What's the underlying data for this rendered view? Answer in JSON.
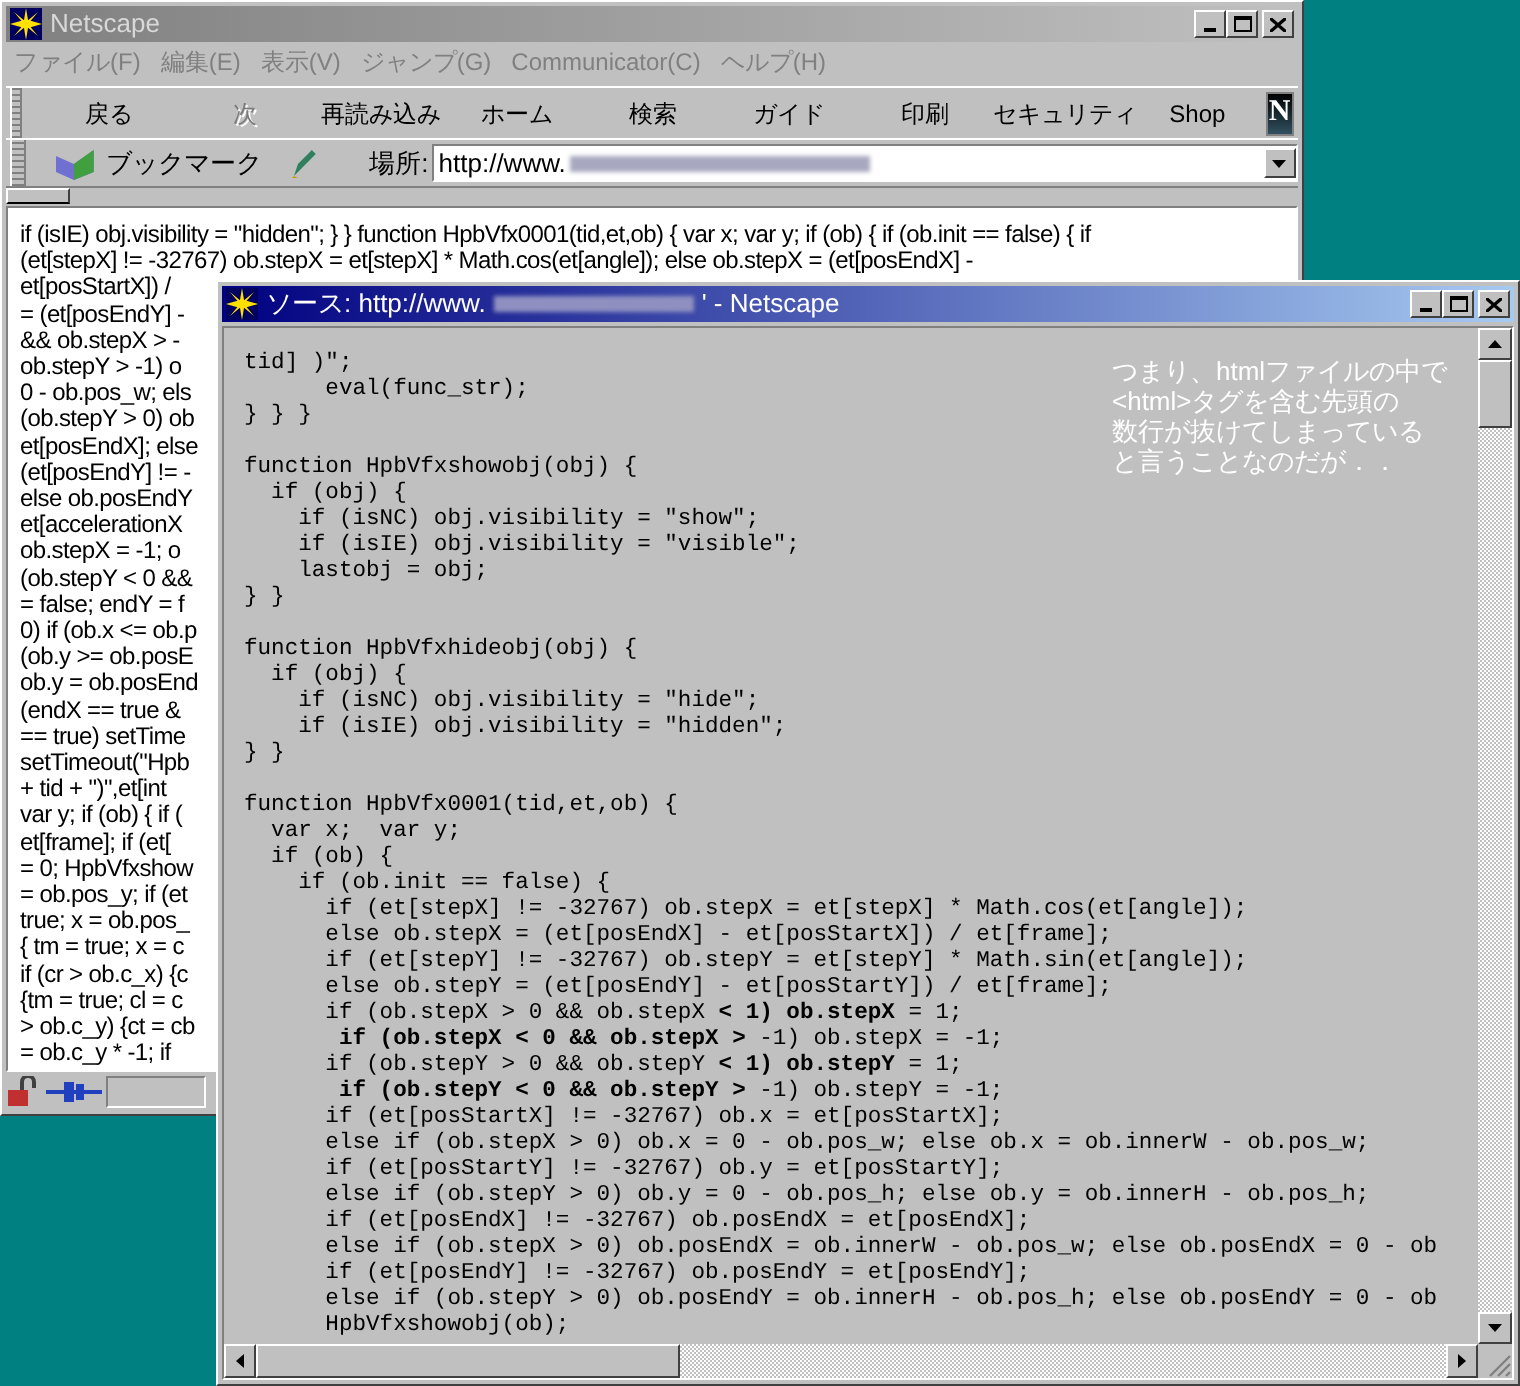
{
  "browser_window": {
    "title": "Netscape",
    "menu": [
      "ファイル(F)",
      "編集(E)",
      "表示(V)",
      "ジャンプ(G)",
      "Communicator(C)",
      "ヘルプ(H)"
    ],
    "toolbar": [
      {
        "label": "戻る",
        "disabled": false
      },
      {
        "label": "次",
        "disabled": true
      },
      {
        "label": "再読み込み",
        "disabled": false
      },
      {
        "label": "ホーム",
        "disabled": false
      },
      {
        "label": "検索",
        "disabled": false
      },
      {
        "label": "ガイド",
        "disabled": false
      },
      {
        "label": "印刷",
        "disabled": false
      },
      {
        "label": "セキュリティ",
        "disabled": false
      },
      {
        "label": "Shop",
        "disabled": false
      }
    ],
    "logo": "N",
    "bookmarks_label": "ブックマーク",
    "location_label": "場所:",
    "location_value": "http://www.",
    "page_lines": [
      "if (isIE) obj.visibility = \"hidden\"; } } function HpbVfx0001(tid,et,ob) { var x; var y; if (ob) { if (ob.init == false) { if",
      "(et[stepX] != -32767) ob.stepX = et[stepX] * Math.cos(et[angle]); else ob.stepX = (et[posEndX] -",
      "et[posStartX]) /",
      "= (et[posEndY] -",
      "&& ob.stepX > -",
      "ob.stepY > -1) o",
      "0 - ob.pos_w; els",
      "(ob.stepY > 0) ob",
      "et[posEndX]; else",
      "(et[posEndY] != -",
      "else ob.posEndY",
      "et[accelerationX",
      "ob.stepX = -1; o",
      "(ob.stepY < 0 &&",
      "= false; endY = f",
      "0) if (ob.x <= ob.p",
      "(ob.y >= ob.posE",
      "ob.y = ob.posEnd",
      "(endX == true &",
      "== true) setTime",
      "setTimeout(\"Hpb",
      "+ tid + \")\",et[int",
      "var y; if (ob) { if (",
      "et[frame]; if (et[",
      "= 0; HpbVfxshow",
      "= ob.pos_y; if (et",
      "true; x = ob.pos_",
      "{ tm = true; x = c",
      "if (cr > ob.c_x) {c",
      "{tm = true; cl = c",
      "> ob.c_y) {ct = cb",
      "= ob.c_y * -1; if"
    ]
  },
  "source_window": {
    "title_prefix": "ソース: http://www.",
    "title_suffix": "' - Netscape",
    "code_blocks": [
      [
        "tid] )\";",
        "      eval(func_str);",
        "} } }"
      ],
      [
        "function HpbVfxshowobj(obj) {",
        "  if (obj) {",
        "    if (isNC) obj.visibility = \"show\";",
        "    if (isIE) obj.visibility = \"visible\";",
        "    lastobj = obj;",
        "} }"
      ],
      [
        "function HpbVfxhideobj(obj) {",
        "  if (obj) {",
        "    if (isNC) obj.visibility = \"hide\";",
        "    if (isIE) obj.visibility = \"hidden\";",
        "} }"
      ],
      [
        "function HpbVfx0001(tid,et,ob) {",
        "  var x;  var y;",
        "  if (ob) {",
        "    if (ob.init == false) {",
        "      if (et[stepX] != -32767) ob.stepX = et[stepX] * Math.cos(et[angle]);",
        "      else ob.stepX = (et[posEndX] - et[posStartX]) / et[frame];",
        "      if (et[stepY] != -32767) ob.stepY = et[stepY] * Math.sin(et[angle]);",
        "      else ob.stepY = (et[posEndY] - et[posStartY]) / et[frame];",
        "      if (ob.stepX > 0 && ob.stepX **< 1) ob.stepX** = 1;",
        "       **if (ob.stepX < 0 && ob.stepX >** -1) ob.stepX = -1;",
        "      if (ob.stepY > 0 && ob.stepY **< 1) ob.stepY** = 1;",
        "       **if (ob.stepY < 0 && ob.stepY >** -1) ob.stepY = -1;",
        "      if (et[posStartX] != -32767) ob.x = et[posStartX];",
        "      else if (ob.stepX > 0) ob.x = 0 - ob.pos_w; else ob.x = ob.innerW - ob.pos_w;",
        "      if (et[posStartY] != -32767) ob.y = et[posStartY];",
        "      else if (ob.stepY > 0) ob.y = 0 - ob.pos_h; else ob.y = ob.innerH - ob.pos_h;",
        "      if (et[posEndX] != -32767) ob.posEndX = et[posEndX];",
        "      else if (ob.stepX > 0) ob.posEndX = ob.innerW - ob.pos_w; else ob.posEndX = 0 - ob",
        "      if (et[posEndY] != -32767) ob.posEndY = et[posEndY];",
        "      else if (ob.stepY > 0) ob.posEndY = ob.innerH - ob.pos_h; else ob.posEndY = 0 - ob",
        "      HpbVfxshowobj(ob);"
      ]
    ],
    "note_lines": [
      "つまり、htmlファイルの中で",
      "<html>タグを含む先頭の",
      "数行が抜けてしまっている",
      "と言うことなのだが．．"
    ]
  }
}
